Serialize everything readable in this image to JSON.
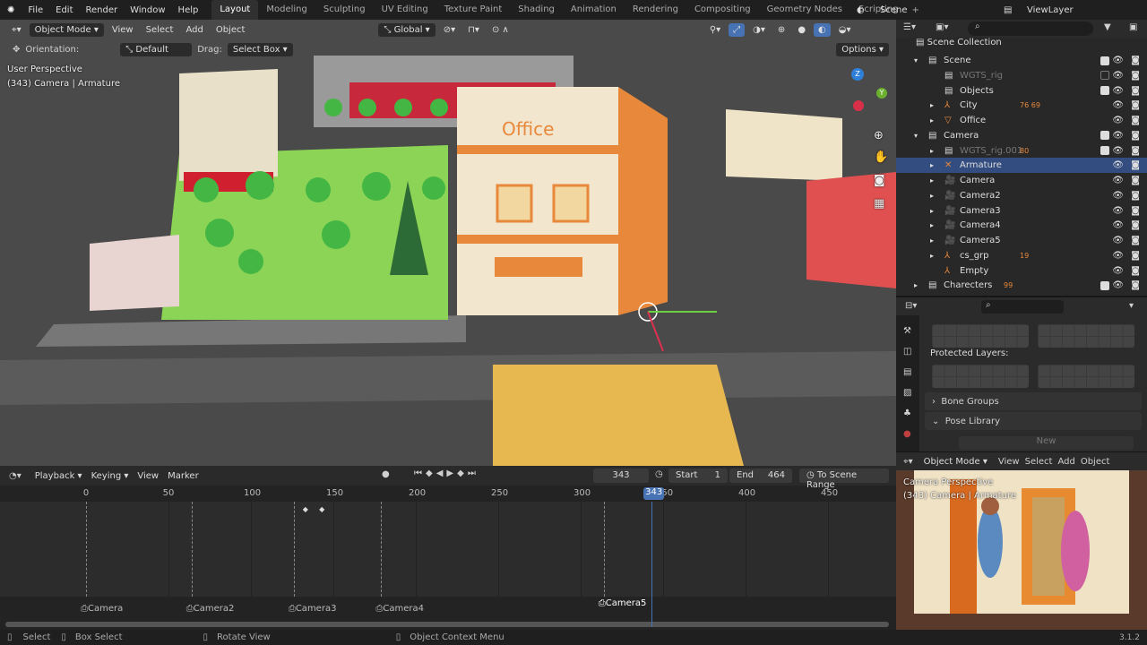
{
  "menu": {
    "items": [
      "File",
      "Edit",
      "Render",
      "Window",
      "Help"
    ]
  },
  "workspaces": [
    "Layout",
    "Modeling",
    "Sculpting",
    "UV Editing",
    "Texture Paint",
    "Shading",
    "Animation",
    "Rendering",
    "Compositing",
    "Geometry Nodes",
    "Scripting"
  ],
  "active_workspace": "Layout",
  "scene_name": "Scene",
  "view_layer": "ViewLayer",
  "viewport": {
    "mode": "Object Mode",
    "menus": [
      "View",
      "Select",
      "Add",
      "Object"
    ],
    "orientation_transform": "Global",
    "tool": {
      "orientation_label": "Orientation:",
      "orientation": "Default",
      "drag_label": "Drag:",
      "drag": "Select Box"
    },
    "options": "Options",
    "view_name": "User Perspective",
    "object_info": "(343) Camera | Armature",
    "scene_label": "Office"
  },
  "outliner": {
    "root": "Scene Collection",
    "items": [
      {
        "label": "Scene",
        "indent": 1,
        "expanded": true,
        "type": "collection",
        "checkbox": true
      },
      {
        "label": "WGTS_rig",
        "indent": 2,
        "type": "collection",
        "dim": true,
        "checkbox": false
      },
      {
        "label": "Objects",
        "indent": 2,
        "type": "collection",
        "checkbox": true
      },
      {
        "label": "City",
        "indent": 2,
        "type": "empty",
        "badge": "76 69"
      },
      {
        "label": "Office",
        "indent": 2,
        "type": "mesh"
      },
      {
        "label": "Camera",
        "indent": 1,
        "expanded": true,
        "type": "collection",
        "checkbox": true
      },
      {
        "label": "WGTS_rig.001",
        "indent": 2,
        "type": "collection",
        "dim": true,
        "badge": "80",
        "checkbox": true
      },
      {
        "label": "Armature",
        "indent": 2,
        "type": "armature",
        "selected": true
      },
      {
        "label": "Camera",
        "indent": 2,
        "type": "camera"
      },
      {
        "label": "Camera2",
        "indent": 2,
        "type": "camera"
      },
      {
        "label": "Camera3",
        "indent": 2,
        "type": "camera"
      },
      {
        "label": "Camera4",
        "indent": 2,
        "type": "camera"
      },
      {
        "label": "Camera5",
        "indent": 2,
        "type": "camera"
      },
      {
        "label": "cs_grp",
        "indent": 2,
        "type": "empty",
        "badge": "19"
      },
      {
        "label": "Empty",
        "indent": 2,
        "type": "empty"
      },
      {
        "label": "Charecters",
        "indent": 1,
        "type": "collection",
        "badge": "99",
        "checkbox": true
      }
    ]
  },
  "properties": {
    "protected_layers": "Protected Layers:",
    "bone_groups": "Bone Groups",
    "pose_library": "Pose Library",
    "new_button": "New"
  },
  "preview": {
    "mode": "Object Mode",
    "menus": [
      "View",
      "Select",
      "Add",
      "Object"
    ],
    "view_name": "Camera Perspective",
    "object_info": "(343) Camera | Armature"
  },
  "timeline": {
    "menus": [
      "Playback",
      "Keying",
      "View",
      "Marker"
    ],
    "current_frame": 343,
    "start_label": "Start",
    "start": 1,
    "end_label": "End",
    "end": 464,
    "scene_range": "To Scene Range",
    "ticks": [
      0,
      50,
      100,
      150,
      200,
      250,
      300,
      350,
      400,
      450
    ],
    "keyframes": [
      133,
      143
    ],
    "markers": [
      {
        "name": "Camera",
        "frame": 0
      },
      {
        "name": "Camera2",
        "frame": 64
      },
      {
        "name": "Camera3",
        "frame": 126
      },
      {
        "name": "Camera4",
        "frame": 179
      },
      {
        "name": "Camera5",
        "frame": 314,
        "active": true
      }
    ]
  },
  "status": {
    "select": "Select",
    "box_select": "Box Select",
    "rotate_view": "Rotate View",
    "context_menu": "Object Context Menu",
    "version": "3.1.2"
  },
  "colors": {
    "accent": "#4772b3",
    "selection": "#334d80",
    "object_orange": "#e8883a",
    "data_green": "#3fbf8f"
  }
}
